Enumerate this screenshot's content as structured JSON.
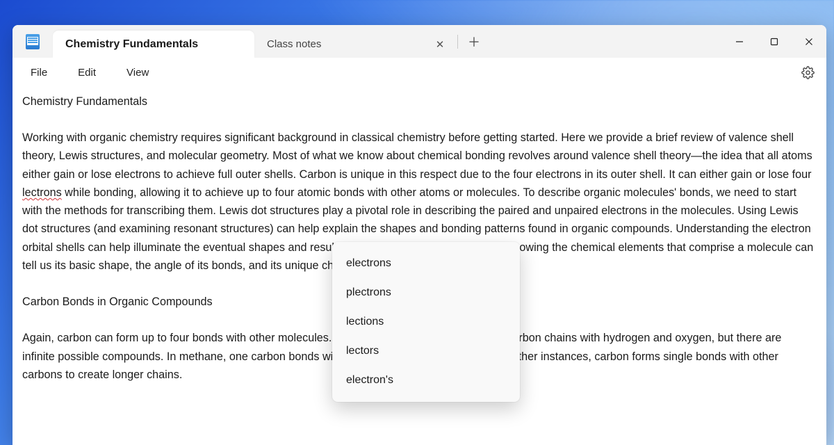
{
  "titlebar": {
    "tabs": [
      {
        "label": "Chemistry Fundamentals",
        "active": true
      },
      {
        "label": "Class notes",
        "active": false
      }
    ]
  },
  "menu": {
    "file": "File",
    "edit": "Edit",
    "view": "View"
  },
  "document": {
    "heading": "Chemistry Fundamentals",
    "p1a": "Working with organic chemistry requires significant background in classical chemistry before getting started. Here we provide a brief review of valence shell theory, Lewis structures, and molecular geometry. Most of what we know about chemical bonding revolves around valence shell theory—the idea that all atoms either gain or lose electrons to achieve full outer shells. Carbon is unique in this respect due to the four electrons in its outer shell. It can either gain or lose four ",
    "err": "lectrons",
    "p1b": " while bonding, allowing it to achieve up to four atomic bonds with other atoms or molecules. To describe organic molecules' bonds, we need to start with the methods for transcribing them. Lewis dot structures play a pivotal role in describing the paired and unpaired electrons in the molecules. Using Lewis dot structures (and examining resonant structures) can help explain the shapes and bonding patterns found in organic compounds. Understanding the electron orbital shells can help illuminate the eventual shapes and resulting bonds in organic compounds. Knowing the chemical elements that comprise a molecule can tell us its basic shape, the angle of its bonds, and its unique characteristics.",
    "subhead": "Carbon Bonds in Organic Compounds",
    "p2": "Again, carbon can form up to four bonds with other molecules. In this course, we mainly focus on carbon chains with hydrogen and oxygen, but there are infinite possible compounds. In methane, one carbon bonds with four hydrogen in single bonds. In other instances, carbon forms single bonds with other carbons to create longer chains."
  },
  "spellcheck": {
    "suggestions": [
      "electrons",
      "plectrons",
      "lections",
      "lectors",
      "electron's"
    ]
  }
}
